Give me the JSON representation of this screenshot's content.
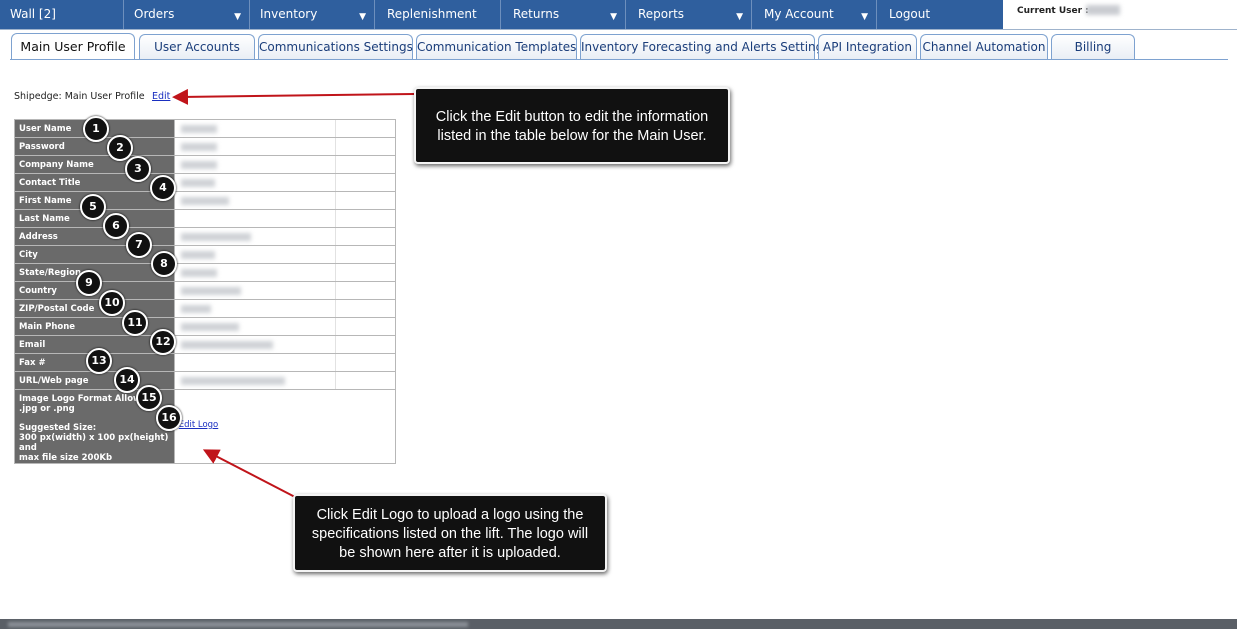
{
  "nav": {
    "items": [
      {
        "label": "Wall [2]",
        "dropdown": false
      },
      {
        "label": "Orders",
        "dropdown": true
      },
      {
        "label": "Inventory",
        "dropdown": true
      },
      {
        "label": "Replenishment",
        "dropdown": false
      },
      {
        "label": "Returns",
        "dropdown": true
      },
      {
        "label": "Reports",
        "dropdown": true
      },
      {
        "label": "My Account",
        "dropdown": true
      },
      {
        "label": "Logout",
        "dropdown": false
      }
    ],
    "current_user_label": "Current User :"
  },
  "tabs": [
    {
      "label": "Main User Profile",
      "active": true
    },
    {
      "label": "User Accounts"
    },
    {
      "label": "Communications Settings"
    },
    {
      "label": "Communication Templates"
    },
    {
      "label": "Inventory Forecasting and Alerts Setting"
    },
    {
      "label": "API Integration"
    },
    {
      "label": "Channel Automation"
    },
    {
      "label": "Billing"
    }
  ],
  "profile": {
    "title": "Shipedge: Main User Profile",
    "edit_label": "Edit",
    "fields": [
      {
        "label": "User Name",
        "marker": "1"
      },
      {
        "label": "Password",
        "marker": "2"
      },
      {
        "label": "Company Name",
        "marker": "3"
      },
      {
        "label": "Contact Title",
        "marker": "4"
      },
      {
        "label": "First Name",
        "marker": "5"
      },
      {
        "label": "Last Name",
        "marker": "6"
      },
      {
        "label": "Address",
        "marker": "7"
      },
      {
        "label": "City",
        "marker": "8"
      },
      {
        "label": "State/Region",
        "marker": "9"
      },
      {
        "label": "Country",
        "marker": "10"
      },
      {
        "label": "ZIP/Postal Code",
        "marker": "11"
      },
      {
        "label": "Main Phone",
        "marker": "12"
      },
      {
        "label": "Email",
        "marker": "13"
      },
      {
        "label": "Fax #",
        "marker": "14"
      },
      {
        "label": "URL/Web page",
        "marker": "15"
      }
    ],
    "logo": {
      "marker": "16",
      "format_line1": "Image Logo Format Allowed:",
      "format_line2": ".jpg or .png",
      "size_line1": "Suggested Size:",
      "size_line2": "300 px(width) x 100 px(height) and",
      "size_line3": "max file size 200Kb",
      "edit_label": "Edit Logo"
    }
  },
  "callouts": {
    "edit_line1": "Click the Edit button to edit the information",
    "edit_line2": "listed in the table below for the Main User.",
    "logo_line1": "Click Edit Logo to upload a logo using the",
    "logo_line2": "specifications listed on the lift. The logo will",
    "logo_line3": "be shown here after it is uploaded."
  },
  "colors": {
    "nav_bg": "#2f5f9e",
    "label_cell_bg": "#6a6a6a",
    "callout_bg": "#111111",
    "arrow": "#c0141a",
    "link": "#1a2fc0"
  }
}
